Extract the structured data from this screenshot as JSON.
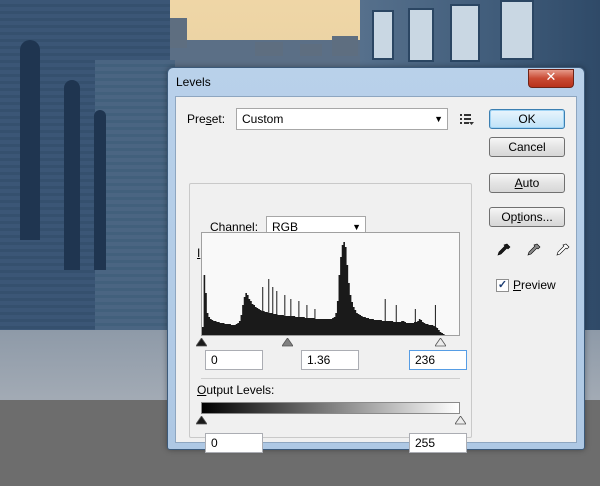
{
  "window": {
    "title": "Levels",
    "close_glyph": "✕"
  },
  "preset": {
    "label": "Preset:",
    "accel": "s",
    "value": "Custom"
  },
  "channel": {
    "label": "Channel:",
    "accel": "C",
    "value": "RGB"
  },
  "input_levels": {
    "label": "Input Levels:",
    "accel": "I",
    "black": "0",
    "gamma": "1.36",
    "white": "236"
  },
  "output_levels": {
    "label": "Output Levels:",
    "accel": "O",
    "black": "0",
    "white": "255"
  },
  "buttons": {
    "ok": "OK",
    "cancel": "Cancel",
    "auto": "Auto",
    "options": "Options..."
  },
  "preview": {
    "label": "Preview",
    "checked": true
  },
  "icons": {
    "close": "close-icon",
    "preset_menu": "preset-menu-icon",
    "dropdown": "chevron-down-icon",
    "black_eyedropper": "black-point-eyedropper-icon",
    "gray_eyedropper": "gray-point-eyedropper-icon",
    "white_eyedropper": "white-point-eyedropper-icon"
  },
  "slider_positions": {
    "input_black": 0,
    "input_gamma_fraction": 0.36,
    "input_white": 236,
    "output_black": 0,
    "output_white": 255
  },
  "histogram": [
    8,
    60,
    42,
    22,
    18,
    16,
    15,
    14,
    14,
    13,
    13,
    12,
    12,
    12,
    11,
    11,
    11,
    11,
    10,
    10,
    10,
    11,
    12,
    14,
    20,
    30,
    38,
    42,
    40,
    36,
    34,
    31,
    30,
    28,
    27,
    26,
    25,
    24,
    24,
    23,
    23,
    22,
    22,
    22,
    21,
    21,
    21,
    20,
    20,
    20,
    20,
    19,
    19,
    19,
    19,
    19,
    19,
    19,
    18,
    18,
    18,
    18,
    18,
    18,
    17,
    17,
    17,
    17,
    17,
    17,
    16,
    16,
    16,
    16,
    16,
    16,
    16,
    16,
    16,
    16,
    16,
    17,
    18,
    22,
    34,
    60,
    78,
    90,
    93,
    88,
    70,
    52,
    40,
    33,
    28,
    25,
    22,
    21,
    20,
    19,
    18,
    18,
    17,
    17,
    16,
    16,
    16,
    15,
    15,
    15,
    15,
    15,
    14,
    14,
    14,
    14,
    14,
    14,
    14,
    13,
    13,
    13,
    13,
    13,
    14,
    14,
    13,
    12,
    12,
    12,
    12,
    12,
    13,
    13,
    14,
    16,
    15,
    13,
    12,
    11,
    11,
    10,
    10,
    10,
    9,
    8,
    7,
    5,
    3,
    2,
    1,
    0,
    0,
    0,
    0,
    0,
    0,
    0,
    0,
    0
  ],
  "histogram_spikes": {
    "60": 48,
    "66": 56,
    "70": 48,
    "74": 44,
    "82": 40,
    "88": 36,
    "96": 34,
    "104": 30,
    "112": 26,
    "182": 36,
    "193": 30,
    "212": 26,
    "232": 30
  },
  "colors": {
    "titlebar": "#b9d1ea",
    "histogram_fill": "#1a1a1a",
    "default_button_border": "#3c7fb1"
  }
}
